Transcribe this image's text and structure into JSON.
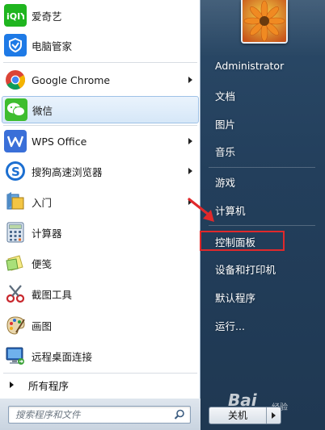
{
  "programs": [
    {
      "label": "爱奇艺",
      "icon": "iqiyi-icon",
      "has_submenu": false
    },
    {
      "label": "电脑管家",
      "icon": "shield-icon",
      "has_submenu": false
    },
    {
      "label": "Google Chrome",
      "icon": "chrome-icon",
      "has_submenu": true
    },
    {
      "label": "微信",
      "icon": "wechat-icon",
      "has_submenu": false,
      "selected": true
    },
    {
      "label": "WPS Office",
      "icon": "wps-icon",
      "has_submenu": true
    },
    {
      "label": "搜狗高速浏览器",
      "icon": "sogou-browser-icon",
      "has_submenu": true
    },
    {
      "label": "入门",
      "icon": "getting-started-icon",
      "has_submenu": true
    },
    {
      "label": "计算器",
      "icon": "calculator-icon",
      "has_submenu": false
    },
    {
      "label": "便笺",
      "icon": "sticky-notes-icon",
      "has_submenu": false
    },
    {
      "label": "截图工具",
      "icon": "snipping-tool-icon",
      "has_submenu": false
    },
    {
      "label": "画图",
      "icon": "paint-icon",
      "has_submenu": false
    },
    {
      "label": "远程桌面连接",
      "icon": "remote-desktop-icon",
      "has_submenu": false
    }
  ],
  "all_programs_label": "所有程序",
  "search": {
    "placeholder": "搜索程序和文件"
  },
  "right_menu": {
    "user": "Administrator",
    "documents": "文档",
    "pictures": "图片",
    "music": "音乐",
    "games": "游戏",
    "computer": "计算机",
    "control_panel": "控制面板",
    "devices_printers": "设备和打印机",
    "default_programs": "默认程序",
    "run": "运行..."
  },
  "shutdown_label": "关机",
  "watermark": {
    "main": "Bai",
    "sub": "经验"
  },
  "colors": {
    "highlight": "#e0292b",
    "panel": "#233f5c",
    "selected": "#d6e7f8"
  }
}
